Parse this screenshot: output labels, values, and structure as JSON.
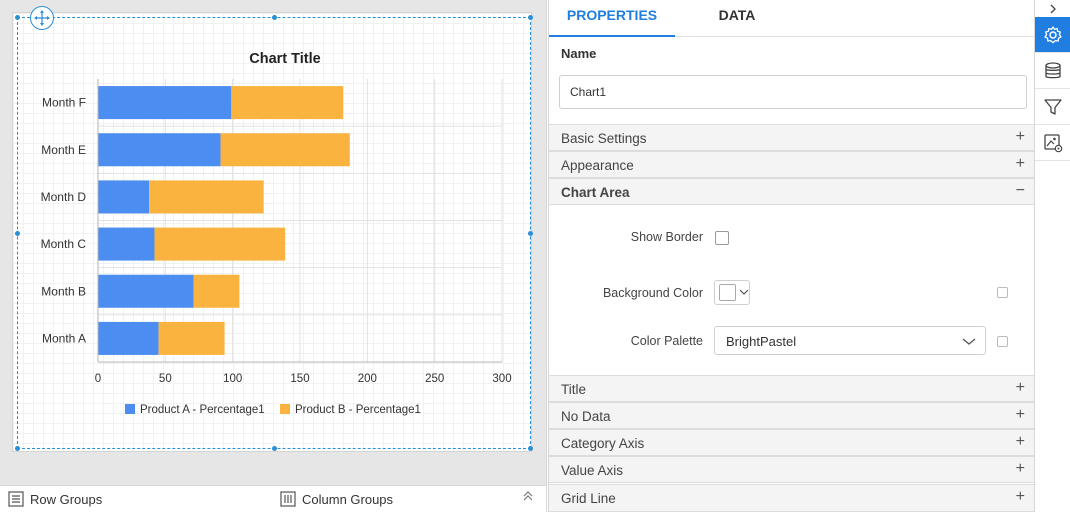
{
  "designer": {
    "bottom_bar": {
      "row_groups_label": "Row Groups",
      "column_groups_label": "Column Groups"
    }
  },
  "chart_data": {
    "type": "bar",
    "orientation": "horizontal",
    "stacked": true,
    "title": "Chart Title",
    "categories": [
      "Month A",
      "Month B",
      "Month C",
      "Month D",
      "Month E",
      "Month F"
    ],
    "series": [
      {
        "name": "Product A - Percentage1",
        "color": "#4b8df0",
        "values": [
          45,
          71,
          42,
          38,
          91,
          99
        ]
      },
      {
        "name": "Product B - Percentage1",
        "color": "#fbb340",
        "values": [
          49,
          34,
          97,
          85,
          96,
          83
        ]
      }
    ],
    "xlim": [
      0,
      300
    ],
    "xticks": [
      "0",
      "50",
      "100",
      "150",
      "200",
      "250",
      "300"
    ],
    "grid": true,
    "legend_position": "bottom"
  },
  "panel": {
    "tabs": [
      {
        "label": "PROPERTIES",
        "active": true
      },
      {
        "label": "DATA",
        "active": false
      }
    ],
    "name_label": "Name",
    "name_value": "Chart1",
    "sections": {
      "basic_settings": {
        "label": "Basic Settings",
        "sign": "+"
      },
      "appearance": {
        "label": "Appearance",
        "sign": "+"
      },
      "chart_area": {
        "label": "Chart Area",
        "sign": "−"
      },
      "title": {
        "label": "Title",
        "sign": "+"
      },
      "no_data": {
        "label": "No Data",
        "sign": "+"
      },
      "category_axis": {
        "label": "Category Axis",
        "sign": "+"
      },
      "value_axis": {
        "label": "Value Axis",
        "sign": "+"
      },
      "grid_line": {
        "label": "Grid Line",
        "sign": "+"
      }
    },
    "chart_area": {
      "show_border_label": "Show Border",
      "show_border_checked": false,
      "background_color_label": "Background Color",
      "background_color_value": "#ffffff",
      "color_palette_label": "Color Palette",
      "color_palette_value": "BrightPastel"
    }
  },
  "toolbar": {
    "expand_icon": "chevron-right-icon",
    "buttons": [
      "gear-icon",
      "database-icon",
      "filter-icon",
      "image-settings-icon"
    ],
    "active_button": "gear-icon",
    "accent_color": "#1f7ee0"
  }
}
